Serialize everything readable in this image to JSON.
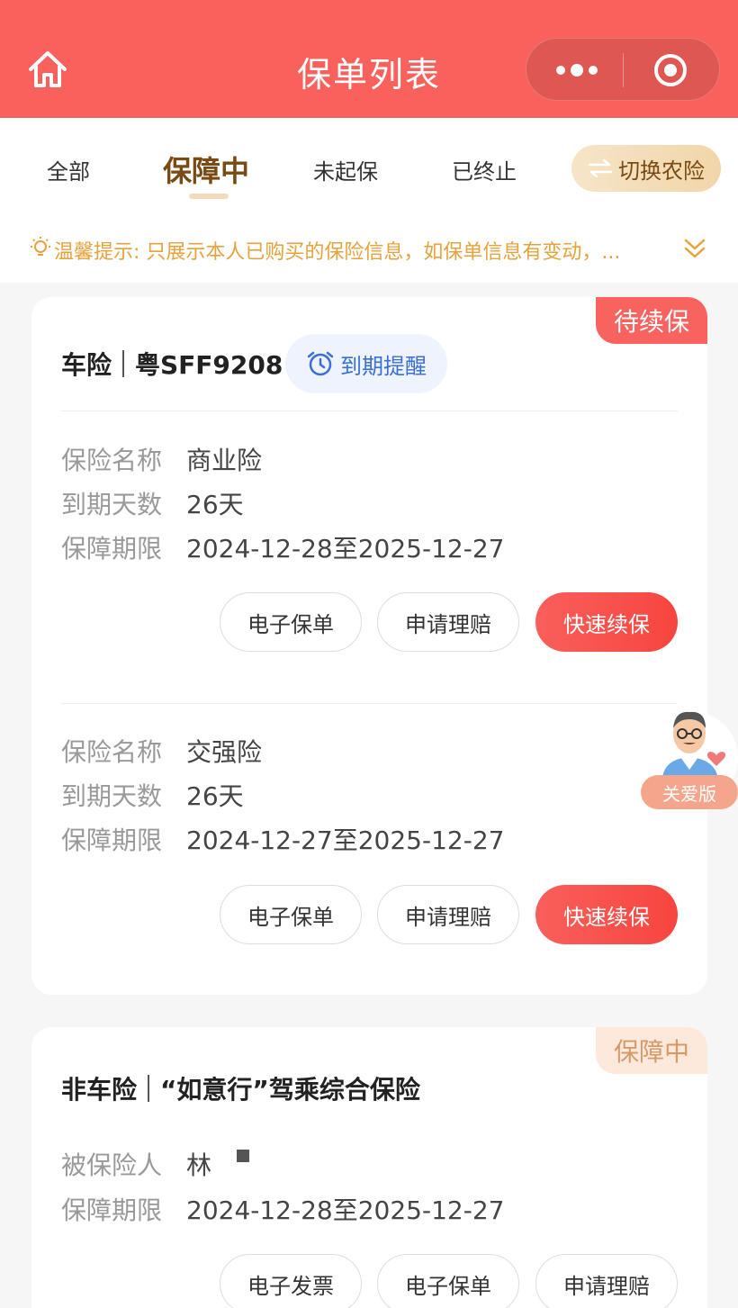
{
  "header": {
    "title": "保单列表"
  },
  "tabs": [
    {
      "label": "全部"
    },
    {
      "label": "保障中"
    },
    {
      "label": "未起保"
    },
    {
      "label": "已终止"
    }
  ],
  "switch_label": "切换农险",
  "notice": "温馨提示: 只展示本人已购买的保险信息，如保单信息有变动，...",
  "card1": {
    "badge": "待续保",
    "type": "车险",
    "plate": "粤SFF9208",
    "remind": "到期提醒",
    "policies": [
      {
        "name_label": "保险名称",
        "name": "商业险",
        "days_label": "到期天数",
        "days": "26天",
        "period_label": "保障期限",
        "period": "2024-12-28至2025-12-27",
        "btn_policy": "电子保单",
        "btn_claim": "申请理赔",
        "btn_renew": "快速续保"
      },
      {
        "name_label": "保险名称",
        "name": "交强险",
        "days_label": "到期天数",
        "days": "26天",
        "period_label": "保障期限",
        "period": "2024-12-27至2025-12-27",
        "btn_policy": "电子保单",
        "btn_claim": "申请理赔",
        "btn_renew": "快速续保"
      }
    ]
  },
  "card2": {
    "badge": "保障中",
    "type": "非车险",
    "product": "“如意行”驾乘综合保险",
    "insured_label": "被保险人",
    "insured": "林",
    "period_label": "保障期限",
    "period": "2024-12-28至2025-12-27",
    "btn_invoice": "电子发票",
    "btn_policy": "电子保单",
    "btn_claim": "申请理赔"
  },
  "care_label": "关爱版",
  "colors": {
    "brand": "#f9615d",
    "gold": "#7a4a14",
    "notice": "#e6a23c"
  }
}
